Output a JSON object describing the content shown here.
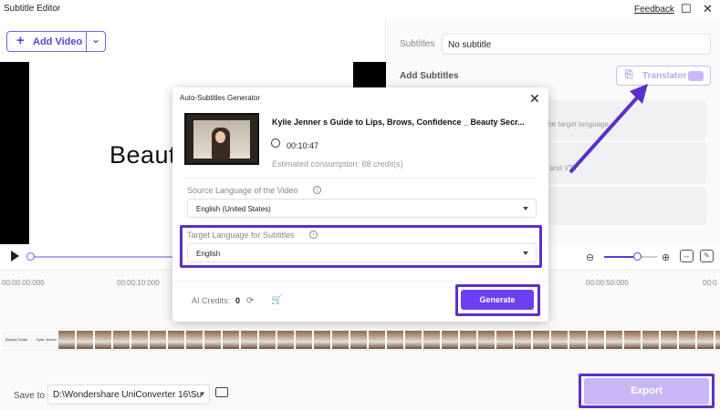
{
  "window": {
    "title": "Subtitle Editor",
    "feedback": "Feedback",
    "minimize": "☐",
    "close": "✕"
  },
  "toolbar": {
    "add_video": "Add Video",
    "add_icon": "+",
    "dropdown_icon": "⌄"
  },
  "preview": {
    "overlay_text": "Beauty"
  },
  "right_panel": {
    "subtitles_label": "Subtitles",
    "subtitles_value": "No subtitle",
    "add_subtitles_label": "Add Subtitles",
    "translator_label": "Translator",
    "cards": [
      {
        "text": "the target language"
      },
      {
        "text": ", and VTT"
      }
    ]
  },
  "timeline": {
    "ticks": [
      "00:00:00:000",
      "00:00:10:000",
      "00:00:50:000",
      "00:0"
    ],
    "film_first": [
      "Beauty Guide",
      "Kylie Jenner"
    ]
  },
  "bottom": {
    "save_to_label": "Save to",
    "save_path": "D:\\Wondershare UniConverter 16\\Su",
    "export_label": "Export"
  },
  "dialog": {
    "title": "Auto-Subtitles Generator",
    "close": "✕",
    "video_title": "Kylie Jenner s Guide to Lips, Brows, Confidence _ Beauty Secr...",
    "duration": "00:10:47",
    "estimate": "Estimated consumption: 88 credit(s)",
    "source_label": "Source Language of the Video",
    "source_value": "English (United States)",
    "target_label": "Target Language for Subtitles",
    "target_value": "English",
    "ai_credits_label": "AI Credits:",
    "ai_credits_value": "0",
    "generate_label": "Generate"
  },
  "colors": {
    "accent": "#6d3ff0",
    "highlight": "#5b2fc9",
    "export_disabled": "#c8b6f5"
  }
}
